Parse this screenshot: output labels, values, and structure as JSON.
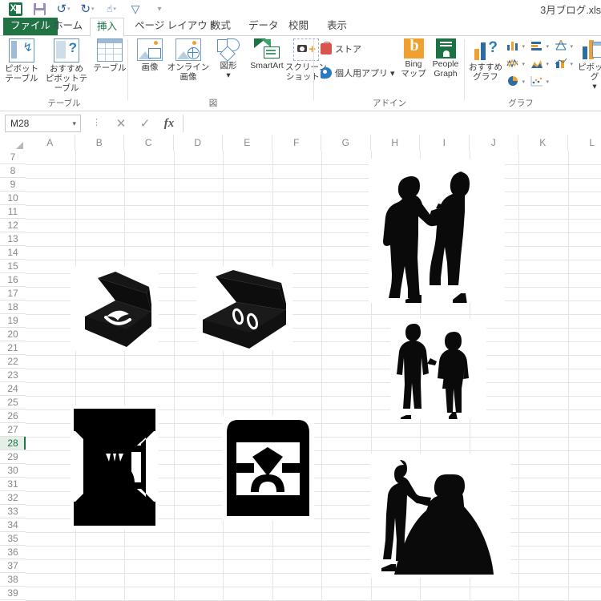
{
  "window": {
    "document_title": "3月ブログ.xls",
    "quick_access": [
      {
        "name": "excel-logo",
        "label": "Excel"
      },
      {
        "name": "save-icon",
        "label": "上書き保存"
      },
      {
        "name": "undo-icon",
        "label": "元に戻す"
      },
      {
        "name": "redo-icon",
        "label": "やり直し"
      },
      {
        "name": "touch-mode-icon",
        "label": "タッチ/マウス モードの切り替え"
      },
      {
        "name": "filter-icon",
        "label": "フィルター"
      },
      {
        "name": "customize-qat-icon",
        "label": "クイック アクセス ツール バーのユーザー設定"
      }
    ]
  },
  "ribbon": {
    "tabs": [
      {
        "label": "ファイル",
        "active": false,
        "file": true
      },
      {
        "label": "ホーム",
        "active": false
      },
      {
        "label": "挿入",
        "active": true
      },
      {
        "label": "ページ レイアウト",
        "active": false
      },
      {
        "label": "数式",
        "active": false
      },
      {
        "label": "データ",
        "active": false
      },
      {
        "label": "校閲",
        "active": false
      },
      {
        "label": "表示",
        "active": false
      }
    ],
    "groups": [
      {
        "name": "tables",
        "label": "テーブル",
        "items": [
          {
            "label_line1": "ピボット",
            "label_line2": "テーブル",
            "icon": "pivot-table-icon"
          },
          {
            "label_line1": "おすすめ",
            "label_line2": "ピボットテーブル",
            "icon": "recommended-pivot-table-icon"
          },
          {
            "label_line1": "テーブル",
            "label_line2": "",
            "icon": "table-icon"
          }
        ]
      },
      {
        "name": "illustrations",
        "label": "図",
        "items": [
          {
            "label_line1": "画像",
            "label_line2": "",
            "icon": "picture-icon"
          },
          {
            "label_line1": "オンライン",
            "label_line2": "画像",
            "icon": "online-picture-icon"
          },
          {
            "label_line1": "図形",
            "label_line2": "▾",
            "icon": "shapes-icon"
          },
          {
            "label_line1": "SmartArt",
            "label_line2": "",
            "icon": "smartart-icon"
          },
          {
            "label_line1": "スクリーン",
            "label_line2": "ショット ▾",
            "icon": "screenshot-icon"
          }
        ]
      },
      {
        "name": "add-ins",
        "label": "アドイン",
        "items": [
          {
            "label_line1": "ストア",
            "label_line2": "",
            "icon": "store-icon"
          },
          {
            "label_line1": "個人用アプリ ▾",
            "label_line2": "",
            "icon": "my-apps-icon"
          },
          {
            "label_line1": "Bing",
            "label_line2": "マップ",
            "icon": "bing-maps-icon"
          },
          {
            "label_line1": "People",
            "label_line2": "Graph",
            "icon": "people-graph-icon"
          }
        ]
      },
      {
        "name": "charts",
        "label": "グラフ",
        "items": [
          {
            "label_line1": "おすすめ",
            "label_line2": "グラフ",
            "icon": "recommended-charts-icon"
          },
          {
            "label_line1": "ピボットグ",
            "label_line2": "▾",
            "icon": "pivot-chart-icon"
          }
        ],
        "chart_types": [
          {
            "name": "column-chart-icon"
          },
          {
            "name": "bar-chart-icon"
          },
          {
            "name": "stock-chart-icon"
          },
          {
            "name": "line-chart-icon"
          },
          {
            "name": "area-chart-icon"
          },
          {
            "name": "combo-chart-icon"
          },
          {
            "name": "pie-chart-icon"
          },
          {
            "name": "scatter-chart-icon"
          }
        ]
      }
    ]
  },
  "formula_bar": {
    "name_box_value": "M28",
    "cancel_label": "✕",
    "enter_label": "✓",
    "fx_label": "fx",
    "formula_value": ""
  },
  "grid": {
    "columns": [
      "A",
      "B",
      "C",
      "D",
      "E",
      "F",
      "G",
      "H",
      "I",
      "J",
      "K",
      "L"
    ],
    "rows": [
      7,
      8,
      9,
      10,
      11,
      12,
      13,
      14,
      15,
      16,
      17,
      18,
      19,
      20,
      21,
      22,
      23,
      24,
      25,
      26,
      27,
      28,
      29,
      30,
      31,
      32,
      33,
      34,
      35,
      36,
      37,
      38,
      39
    ],
    "selected_row": 28,
    "selected_cell": "M28",
    "selection_color": "#217346",
    "images": [
      {
        "name": "picture-ring-box-open-angled",
        "alt": "黒いリングケース（指輪入り）"
      },
      {
        "name": "picture-ring-box-pair-rings",
        "alt": "ペアリング入りケース"
      },
      {
        "name": "picture-proposal-couple-silhouette",
        "alt": "プロポーズするカップルのシルエット"
      },
      {
        "name": "picture-couple-silhouette-simple",
        "alt": "カップルのシルエット"
      },
      {
        "name": "picture-ring-box-icon-diamond",
        "alt": "ダイヤモンドリングボックスのアイコン"
      },
      {
        "name": "picture-ring-box-icon-solid-gem",
        "alt": "リングボックスのアイコン"
      },
      {
        "name": "picture-bride-groom-silhouette",
        "alt": "花嫁と花婿のシルエット"
      }
    ]
  }
}
